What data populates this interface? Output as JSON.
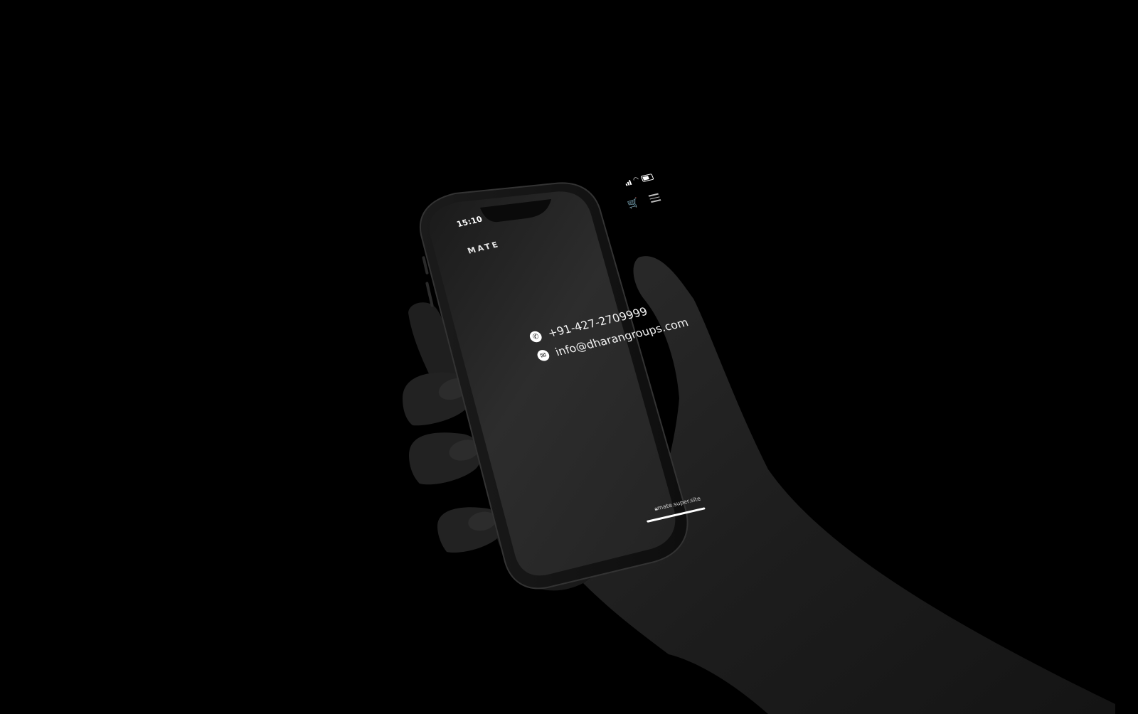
{
  "status_bar": {
    "time": "15:10",
    "icons": [
      "signal-icon",
      "wifi-icon",
      "battery-icon"
    ]
  },
  "header": {
    "logo": "MATE",
    "cart_icon": "cart-icon",
    "menu_icon": "hamburger-menu-icon"
  },
  "contact": {
    "phone": "+91-427-2709999",
    "email": "info@dharangroups.com"
  },
  "browser": {
    "url": "mate.super.site"
  },
  "colors": {
    "background": "#000000",
    "screen": "#262626",
    "text": "#ffffff"
  }
}
